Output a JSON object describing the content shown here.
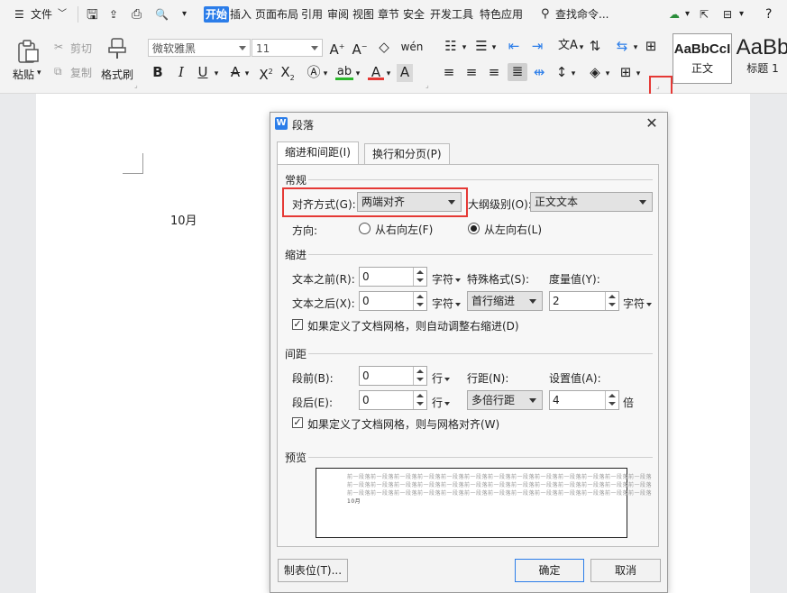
{
  "menubar": {
    "file_label": "文件",
    "tabs": [
      "开始",
      "插入",
      "页面布局",
      "引用",
      "审阅",
      "视图",
      "章节",
      "安全",
      "开发工具",
      "特色应用"
    ],
    "search_label": "查找命令...",
    "help_label": "?"
  },
  "ribbon": {
    "paste_label": "粘贴",
    "cut_label": "剪切",
    "copy_label": "复制",
    "format_painter_label": "格式刷",
    "font_name": "微软雅黑",
    "font_size": "11",
    "styles": [
      {
        "preview": "AaBbCcI",
        "name": "正文"
      },
      {
        "preview": "AaBb",
        "name": "标题 1"
      }
    ]
  },
  "document": {
    "text": "10月"
  },
  "dialog": {
    "title": "段落",
    "tabs": [
      "缩进和间距(I)",
      "换行和分页(P)"
    ],
    "general": {
      "section_title": "常规",
      "alignment_label": "对齐方式(G):",
      "alignment_value": "两端对齐",
      "outline_label": "大纲级别(O):",
      "outline_value": "正文文本",
      "direction_label": "方向:",
      "rtl_label": "从右向左(F)",
      "ltr_label": "从左向右(L)"
    },
    "indent": {
      "section_title": "缩进",
      "before_label": "文本之前(R):",
      "before_value": "0",
      "before_unit": "字符",
      "after_label": "文本之后(X):",
      "after_value": "0",
      "after_unit": "字符",
      "special_label": "特殊格式(S):",
      "special_value": "首行缩进",
      "measure_label": "度量值(Y):",
      "measure_value": "2",
      "measure_unit": "字符",
      "auto_adjust_label": "如果定义了文档网格，则自动调整右缩进(D)"
    },
    "spacing": {
      "section_title": "间距",
      "before_label": "段前(B):",
      "before_value": "0",
      "before_unit": "行",
      "after_label": "段后(E):",
      "after_value": "0",
      "after_unit": "行",
      "line_label": "行距(N):",
      "line_value": "多倍行距",
      "set_label": "设置值(A):",
      "set_value": "4",
      "set_unit": "倍",
      "grid_align_label": "如果定义了文档网格，则与网格对齐(W)"
    },
    "preview": {
      "section_title": "预览",
      "lines": [
        "前一段落前一段落前一段落前一段落前一段落前一段落前一段落前一段落前一段落前一段落前一段落前一段落前一段落",
        "前一段落前一段落前一段落前一段落前一段落前一段落前一段落前一段落前一段落前一段落前一段落前一段落前一段落",
        "前一段落前一段落前一段落前一段落前一段落前一段落前一段落前一段落前一段落前一段落前一段落前一段落前一段落"
      ],
      "sample": "10月"
    },
    "tabs_button": "制表位(T)...",
    "ok_button": "确定",
    "cancel_button": "取消"
  },
  "colors": {
    "accent": "#2b7de9",
    "highlight_border": "#e53935"
  }
}
